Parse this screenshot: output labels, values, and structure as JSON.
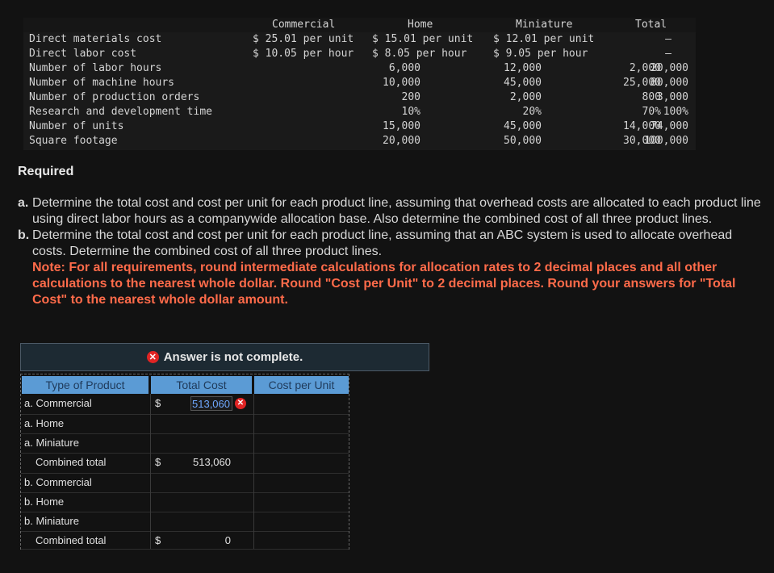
{
  "data_table": {
    "headers": [
      "Commercial",
      "Home",
      "Miniature",
      "Total"
    ],
    "rows": [
      {
        "label": "Direct materials cost",
        "commercial": "$ 25.01 per unit",
        "home": "$ 15.01 per unit",
        "miniature": "$ 12.01 per unit",
        "total": "–"
      },
      {
        "label": "Direct labor cost",
        "commercial": "$ 10.05 per hour",
        "home": "$ 8.05 per hour",
        "miniature": "$ 9.05 per hour",
        "total": "–"
      },
      {
        "label": "Number of labor hours",
        "commercial": "6,000",
        "home": "12,000",
        "miniature": "2,000",
        "total": "20,000"
      },
      {
        "label": "Number of machine hours",
        "commercial": "10,000",
        "home": "45,000",
        "miniature": "25,000",
        "total": "80,000"
      },
      {
        "label": "Number of production orders",
        "commercial": "200",
        "home": "2,000",
        "miniature": "800",
        "total": "3,000"
      },
      {
        "label": "Research and development time",
        "commercial": "10%",
        "home": "20%",
        "miniature": "70%",
        "total": "100%"
      },
      {
        "label": "Number of units",
        "commercial": "15,000",
        "home": "45,000",
        "miniature": "14,000",
        "total": "74,000"
      },
      {
        "label": "Square footage",
        "commercial": "20,000",
        "home": "50,000",
        "miniature": "30,000",
        "total": "100,000"
      }
    ]
  },
  "required": {
    "title": "Required",
    "a_label": "a.",
    "a_text": "Determine the total cost and cost per unit for each product line, assuming that overhead costs are allocated to each product line using direct labor hours as a companywide allocation base. Also determine the combined cost of all three product lines.",
    "b_label": "b.",
    "b_text": "Determine the total cost and cost per unit for each product line, assuming that an ABC system is used to allocate overhead costs. Determine the combined cost of all three product lines.",
    "note": "Note: For all requirements, round intermediate calculations for allocation rates to 2 decimal places and all other calculations to the nearest whole dollar. Round \"Cost per Unit\" to 2 decimal places. Round your answers for \"Total Cost\" to the nearest whole dollar amount."
  },
  "banner": {
    "icon": "x-circle-icon",
    "text": "Answer is not complete."
  },
  "answer_grid": {
    "headers": {
      "type": "Type of Product",
      "total": "Total Cost",
      "cpu": "Cost per Unit"
    },
    "dollar_sign": "$",
    "rows": [
      {
        "label": "a. Commercial",
        "indent": false,
        "dollar": true,
        "total": "513,060",
        "status": "incorrect",
        "cpu": ""
      },
      {
        "label": "a. Home",
        "indent": false,
        "dollar": false,
        "total": "",
        "cpu": ""
      },
      {
        "label": "a. Miniature",
        "indent": false,
        "dollar": false,
        "total": "",
        "cpu": ""
      },
      {
        "label": "Combined total",
        "indent": true,
        "dollar": true,
        "total": "513,060",
        "cpu": ""
      },
      {
        "label": "b. Commercial",
        "indent": false,
        "dollar": false,
        "total": "",
        "cpu": ""
      },
      {
        "label": "b. Home",
        "indent": false,
        "dollar": false,
        "total": "",
        "cpu": ""
      },
      {
        "label": "b. Miniature",
        "indent": false,
        "dollar": false,
        "total": "",
        "cpu": ""
      },
      {
        "label": "Combined total",
        "indent": true,
        "dollar": true,
        "total": "0",
        "cpu": ""
      }
    ]
  },
  "colors": {
    "note": "#ff6b4a",
    "header_fill": "#5b9bd5",
    "error": "#e02424",
    "input_text": "#6fa8ff"
  }
}
